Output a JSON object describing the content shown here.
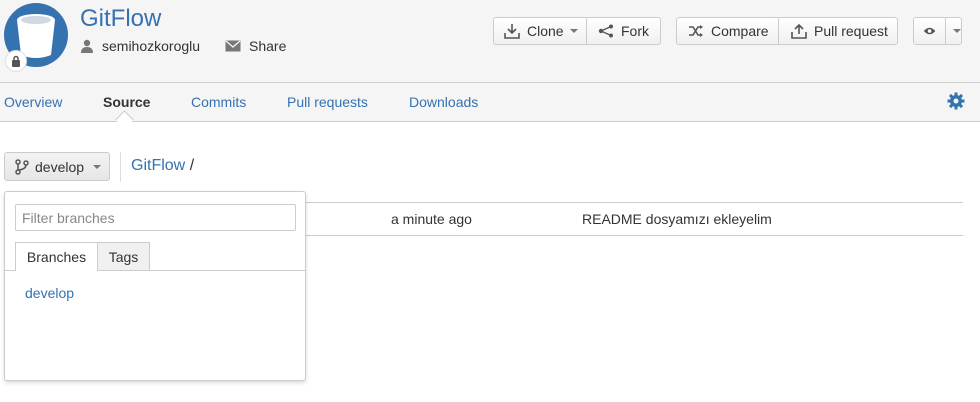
{
  "repo": {
    "title": "GitFlow",
    "owner": "semihozkoroglu",
    "share_label": "Share"
  },
  "actions": {
    "clone": "Clone",
    "fork": "Fork",
    "compare": "Compare",
    "pull_request": "Pull request"
  },
  "nav": {
    "items": [
      "Overview",
      "Source",
      "Commits",
      "Pull requests",
      "Downloads"
    ],
    "active": "Source"
  },
  "source": {
    "branch": "develop",
    "breadcrumb_repo": "GitFlow",
    "breadcrumb_sep": "/"
  },
  "file_row": {
    "time": "a minute ago",
    "message": "README dosyamızı ekleyelim"
  },
  "branch_dropdown": {
    "filter_placeholder": "Filter branches",
    "tabs": [
      "Branches",
      "Tags"
    ],
    "branches": [
      "develop"
    ]
  },
  "colors": {
    "link": "#3572b0",
    "header_bg": "#f5f5f5"
  },
  "icons": [
    "repo-avatar-icon",
    "lock-icon",
    "user-icon",
    "envelope-icon",
    "download-icon",
    "fork-icon",
    "compare-icon",
    "upload-icon",
    "eye-icon",
    "gear-icon",
    "branch-icon"
  ]
}
